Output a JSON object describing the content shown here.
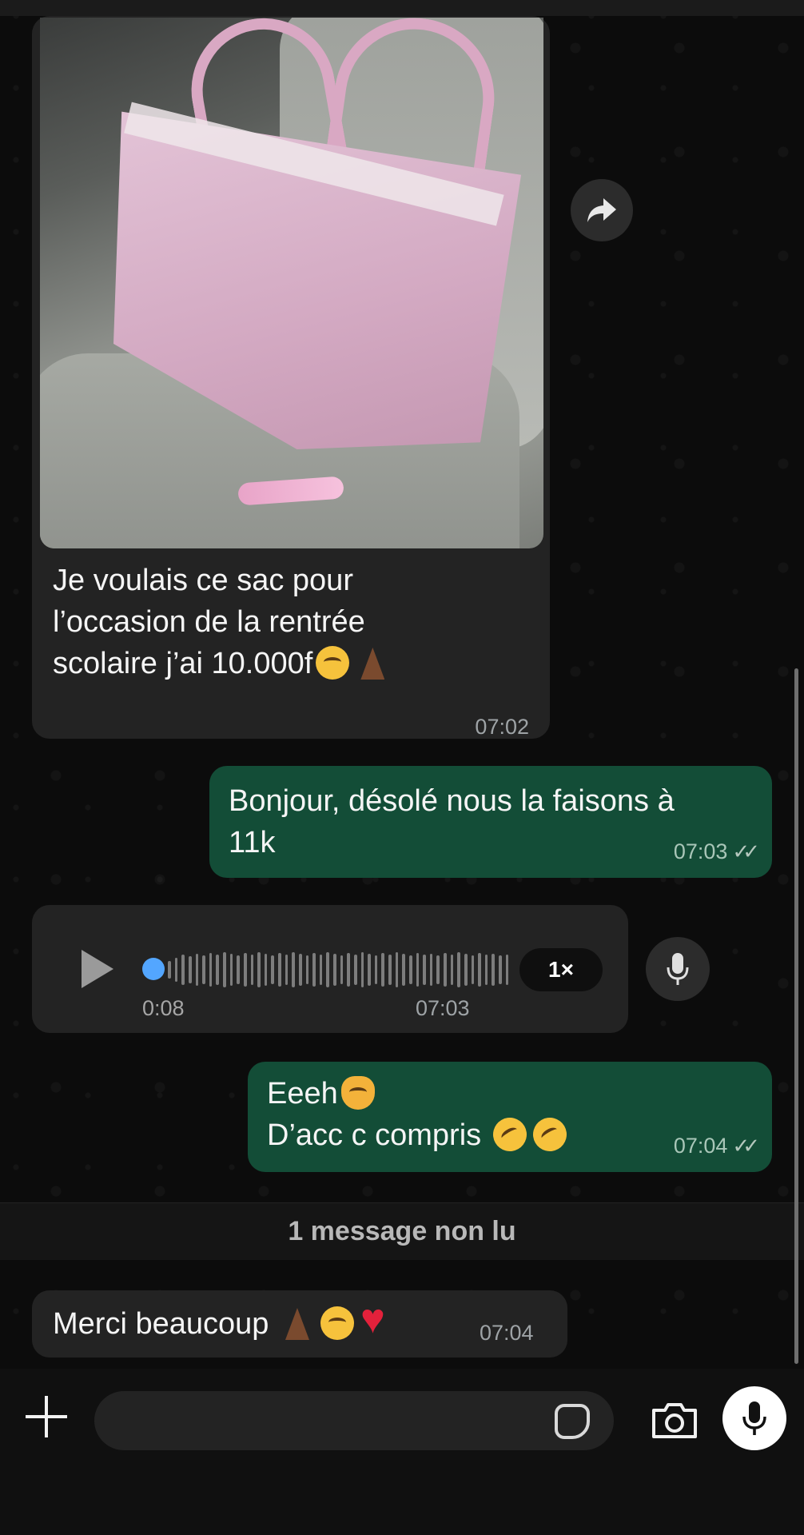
{
  "messages": {
    "image_msg": {
      "caption": "Je voulais ce sac pour\nl’occasion de la rentrée\nscolaire j’ai 10.000f",
      "time": "07:02"
    },
    "reply_1": {
      "text": "Bonjour, désolé nous la faisons à\n11k",
      "time": "07:03",
      "status": "✓✓"
    },
    "voice_msg": {
      "duration": "0:08",
      "time": "07:03",
      "speed": "1×"
    },
    "reply_2": {
      "line1": "Eeeh",
      "line2": "D’acc c compris",
      "time": "07:04",
      "status": "✓✓"
    },
    "unread_divider": "1 message non lu",
    "last_msg": {
      "text": "Merci beaucoup",
      "time": "07:04"
    }
  },
  "input": {
    "placeholder": ""
  },
  "colors": {
    "incoming_bubble": "#232323",
    "outgoing_bubble": "#134d37",
    "voice_progress": "#53a6ff"
  },
  "icons": {
    "forward": "forward-arrow-icon",
    "play": "play-icon",
    "mic": "microphone-icon",
    "plus": "plus-icon",
    "sticker": "sticker-icon",
    "camera": "camera-icon"
  }
}
